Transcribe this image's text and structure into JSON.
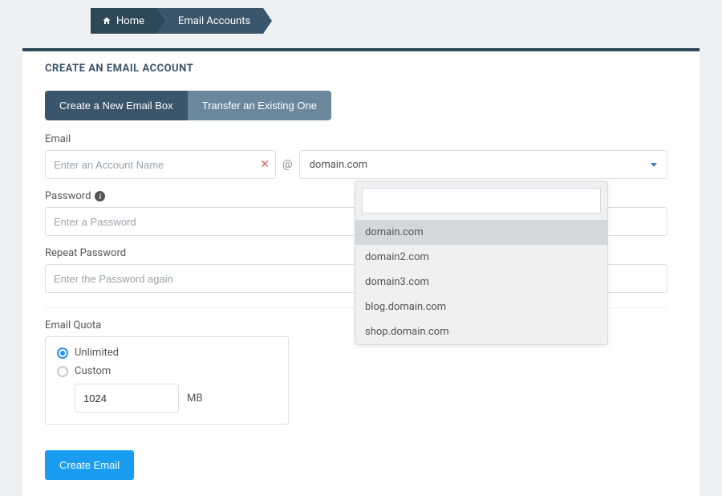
{
  "breadcrumb": {
    "home": "Home",
    "current": "Email Accounts"
  },
  "card": {
    "title": "CREATE AN EMAIL ACCOUNT"
  },
  "tabs": {
    "create": "Create a New Email Box",
    "transfer": "Transfer an Existing One"
  },
  "email": {
    "label": "Email",
    "placeholder": "Enter an Account Name",
    "at": "@",
    "selected_domain": "domain.com",
    "dropdown_options": [
      "domain.com",
      "domain2.com",
      "domain3.com",
      "blog.domain.com",
      "shop.domain.com"
    ]
  },
  "password": {
    "label": "Password",
    "placeholder": "Enter a Password"
  },
  "repeat_password": {
    "label": "Repeat Password",
    "placeholder": "Enter the Password again"
  },
  "quota": {
    "label": "Email Quota",
    "unlimited": "Unlimited",
    "custom": "Custom",
    "custom_value": "1024",
    "unit": "MB"
  },
  "submit": {
    "label": "Create Email"
  }
}
